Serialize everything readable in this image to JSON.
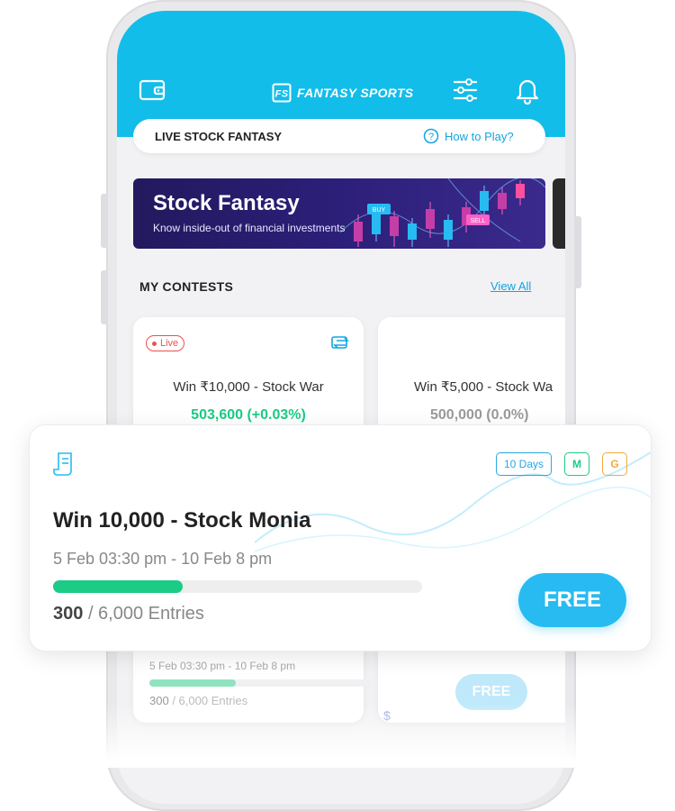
{
  "header": {
    "brand": "FANTASY SPORTS",
    "brand_mark": "FS",
    "icons": [
      "wallet-icon",
      "sliders-icon",
      "bell-icon"
    ],
    "accent_color": "#12bdea"
  },
  "tab_pill": {
    "title": "LIVE STOCK FANTASY",
    "help_label": "How to Play?"
  },
  "banner": {
    "title": "Stock Fantasy",
    "subtitle": "Know inside-out of financial investments",
    "buy_label": "BUY",
    "sell_label": "SELL"
  },
  "contests": {
    "section_title": "MY CONTESTS",
    "view_all": "View All",
    "cards": [
      {
        "status": "Live",
        "title": "Win ₹10,000 - Stock War",
        "value": "503,600 (+0.03%)",
        "value_color": "#1ccb86"
      },
      {
        "title": "Win ₹5,000 - Stock Wa",
        "value": "500,000 (0.0%)",
        "value_color": "#9a9a9a"
      }
    ]
  },
  "featured": {
    "badges": [
      {
        "label": "10 Days",
        "color": "#2aa6e4"
      },
      {
        "label": "M",
        "color": "#1ccb86"
      },
      {
        "label": "G",
        "color": "#f2a93b"
      }
    ],
    "title": "Win 10,000 - Stock Monia",
    "dates": "5 Feb 03:30 pm - 10 Feb 8 pm",
    "progress": 0.35,
    "entries_current": "300",
    "entries_total": "/ 6,000 Entries",
    "button": "FREE"
  },
  "under_card": {
    "dates": "5 Feb 03:30 pm - 10 Feb 8 pm",
    "entries_current": "300",
    "entries_total": "/ 6,000 Entries",
    "button": "FREE",
    "currency_mark": "$"
  }
}
